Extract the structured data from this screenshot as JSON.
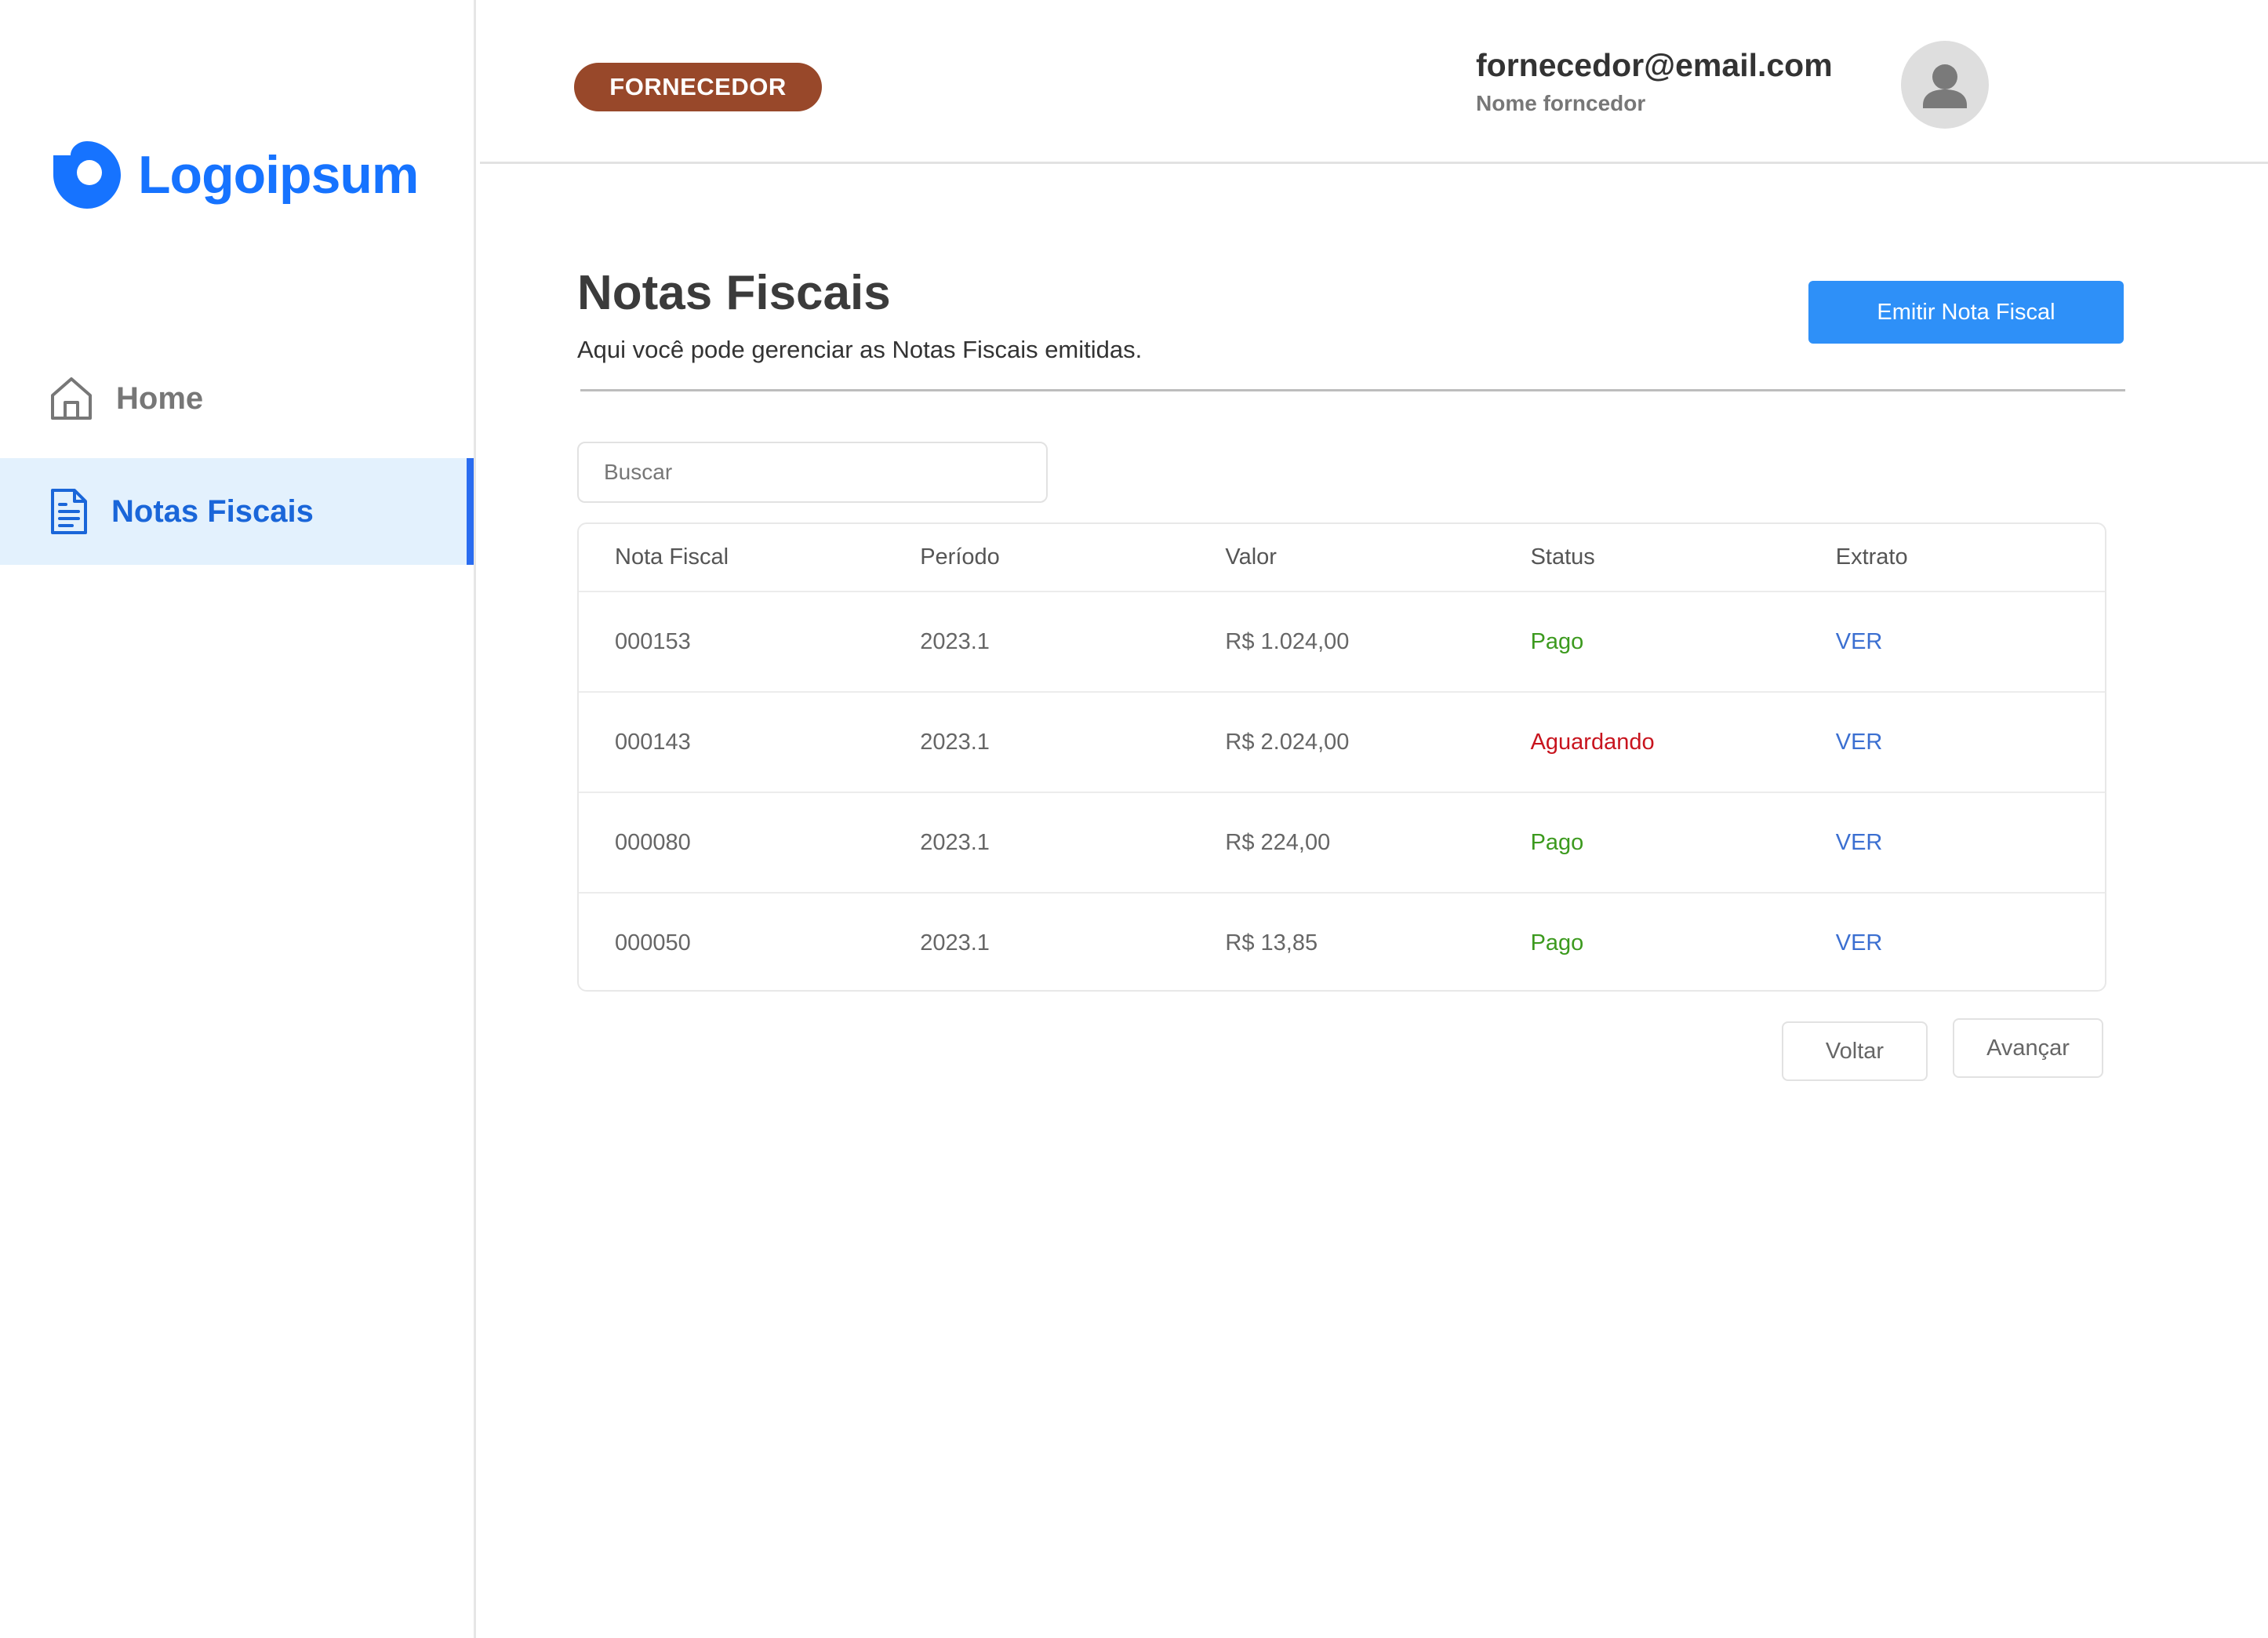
{
  "brand": {
    "name": "Logoipsum",
    "color": "#1673ff"
  },
  "sidebar": {
    "items": [
      {
        "label": "Home",
        "icon": "home-icon",
        "active": false
      },
      {
        "label": "Notas Fiscais",
        "icon": "document-icon",
        "active": true
      }
    ]
  },
  "header": {
    "role_badge": "FORNECEDOR",
    "user_email": "fornecedor@email.com",
    "user_name": "Nome forncedor",
    "avatar_icon": "user-icon"
  },
  "main": {
    "title": "Notas Fiscais",
    "subtitle": "Aqui você pode gerenciar as Notas Fiscais emitidas.",
    "emit_button": "Emitir Nota Fiscal",
    "search_placeholder": "Buscar",
    "table": {
      "columns": [
        "Nota Fiscal",
        "Período",
        "Valor",
        "Status",
        "Extrato"
      ],
      "rows": [
        {
          "nota": "000153",
          "periodo": "2023.1",
          "valor": "R$ 1.024,00",
          "status": "Pago",
          "extrato": "VER"
        },
        {
          "nota": "000143",
          "periodo": "2023.1",
          "valor": "R$ 2.024,00",
          "status": "Aguardando",
          "extrato": "VER"
        },
        {
          "nota": "000080",
          "periodo": "2023.1",
          "valor": "R$ 224,00",
          "status": "Pago",
          "extrato": "VER"
        },
        {
          "nota": "000050",
          "periodo": "2023.1",
          "valor": "R$ 13,85",
          "status": "Pago",
          "extrato": "VER"
        }
      ]
    },
    "pagination": {
      "back": "Voltar",
      "next": "Avançar"
    }
  },
  "colors": {
    "accent": "#2e90f8",
    "badge": "#98482a",
    "active_nav_bg": "#e3f1fd",
    "status_paid": "#3c9a1e",
    "status_waiting": "#c8141e",
    "link": "#3b6fd1"
  }
}
